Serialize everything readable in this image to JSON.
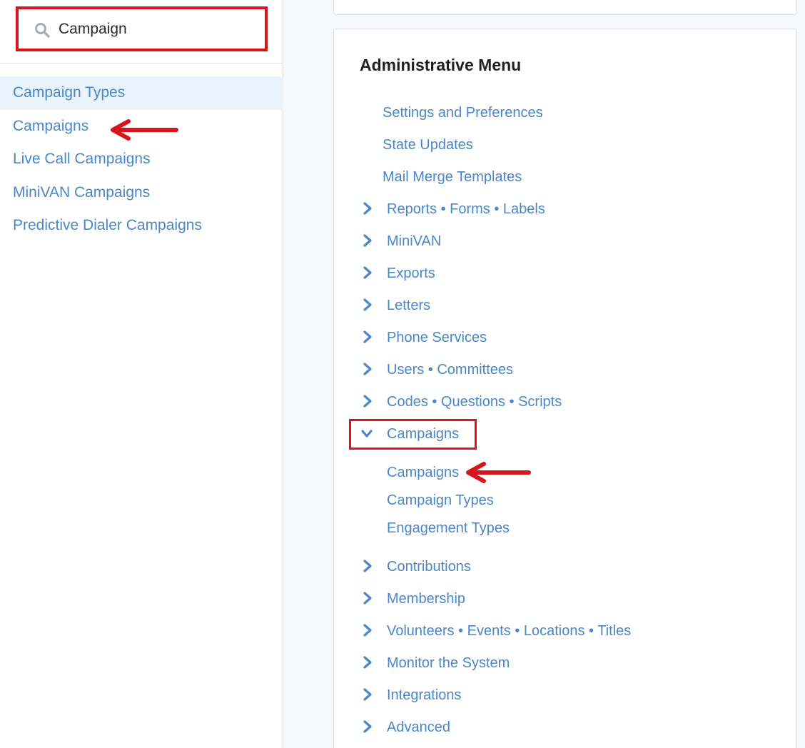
{
  "search": {
    "value": "Campaign",
    "placeholder": ""
  },
  "search_results": [
    {
      "label": "Campaign Types"
    },
    {
      "label": "Campaigns"
    },
    {
      "label": "Live Call Campaigns"
    },
    {
      "label": "MiniVAN Campaigns"
    },
    {
      "label": "Predictive Dialer Campaigns"
    }
  ],
  "admin_menu": {
    "title": "Administrative Menu",
    "plain_links": [
      {
        "label": "Settings and Preferences"
      },
      {
        "label": "State Updates"
      },
      {
        "label": "Mail Merge Templates"
      }
    ],
    "sections_before": [
      {
        "label": "Reports • Forms • Labels"
      },
      {
        "label": "MiniVAN"
      },
      {
        "label": "Exports"
      },
      {
        "label": "Letters"
      },
      {
        "label": "Phone Services"
      },
      {
        "label": "Users • Committees"
      },
      {
        "label": "Codes • Questions • Scripts"
      }
    ],
    "expanded_section": {
      "label": "Campaigns",
      "children": [
        {
          "label": "Campaigns"
        },
        {
          "label": "Campaign Types"
        },
        {
          "label": "Engagement Types"
        }
      ]
    },
    "sections_after": [
      {
        "label": "Contributions"
      },
      {
        "label": "Membership"
      },
      {
        "label": "Volunteers • Events • Locations • Titles"
      },
      {
        "label": "Monitor the System"
      },
      {
        "label": "Integrations"
      },
      {
        "label": "Advanced"
      }
    ]
  },
  "colors": {
    "link": "#4a86c8",
    "annotation_red": "#d8141c",
    "active_row": "#e8f3fb"
  },
  "icons": {
    "search": "search-icon",
    "collapsed": "chevron-right-icon",
    "expanded": "chevron-down-icon",
    "annotation": "red-arrow-icon"
  }
}
